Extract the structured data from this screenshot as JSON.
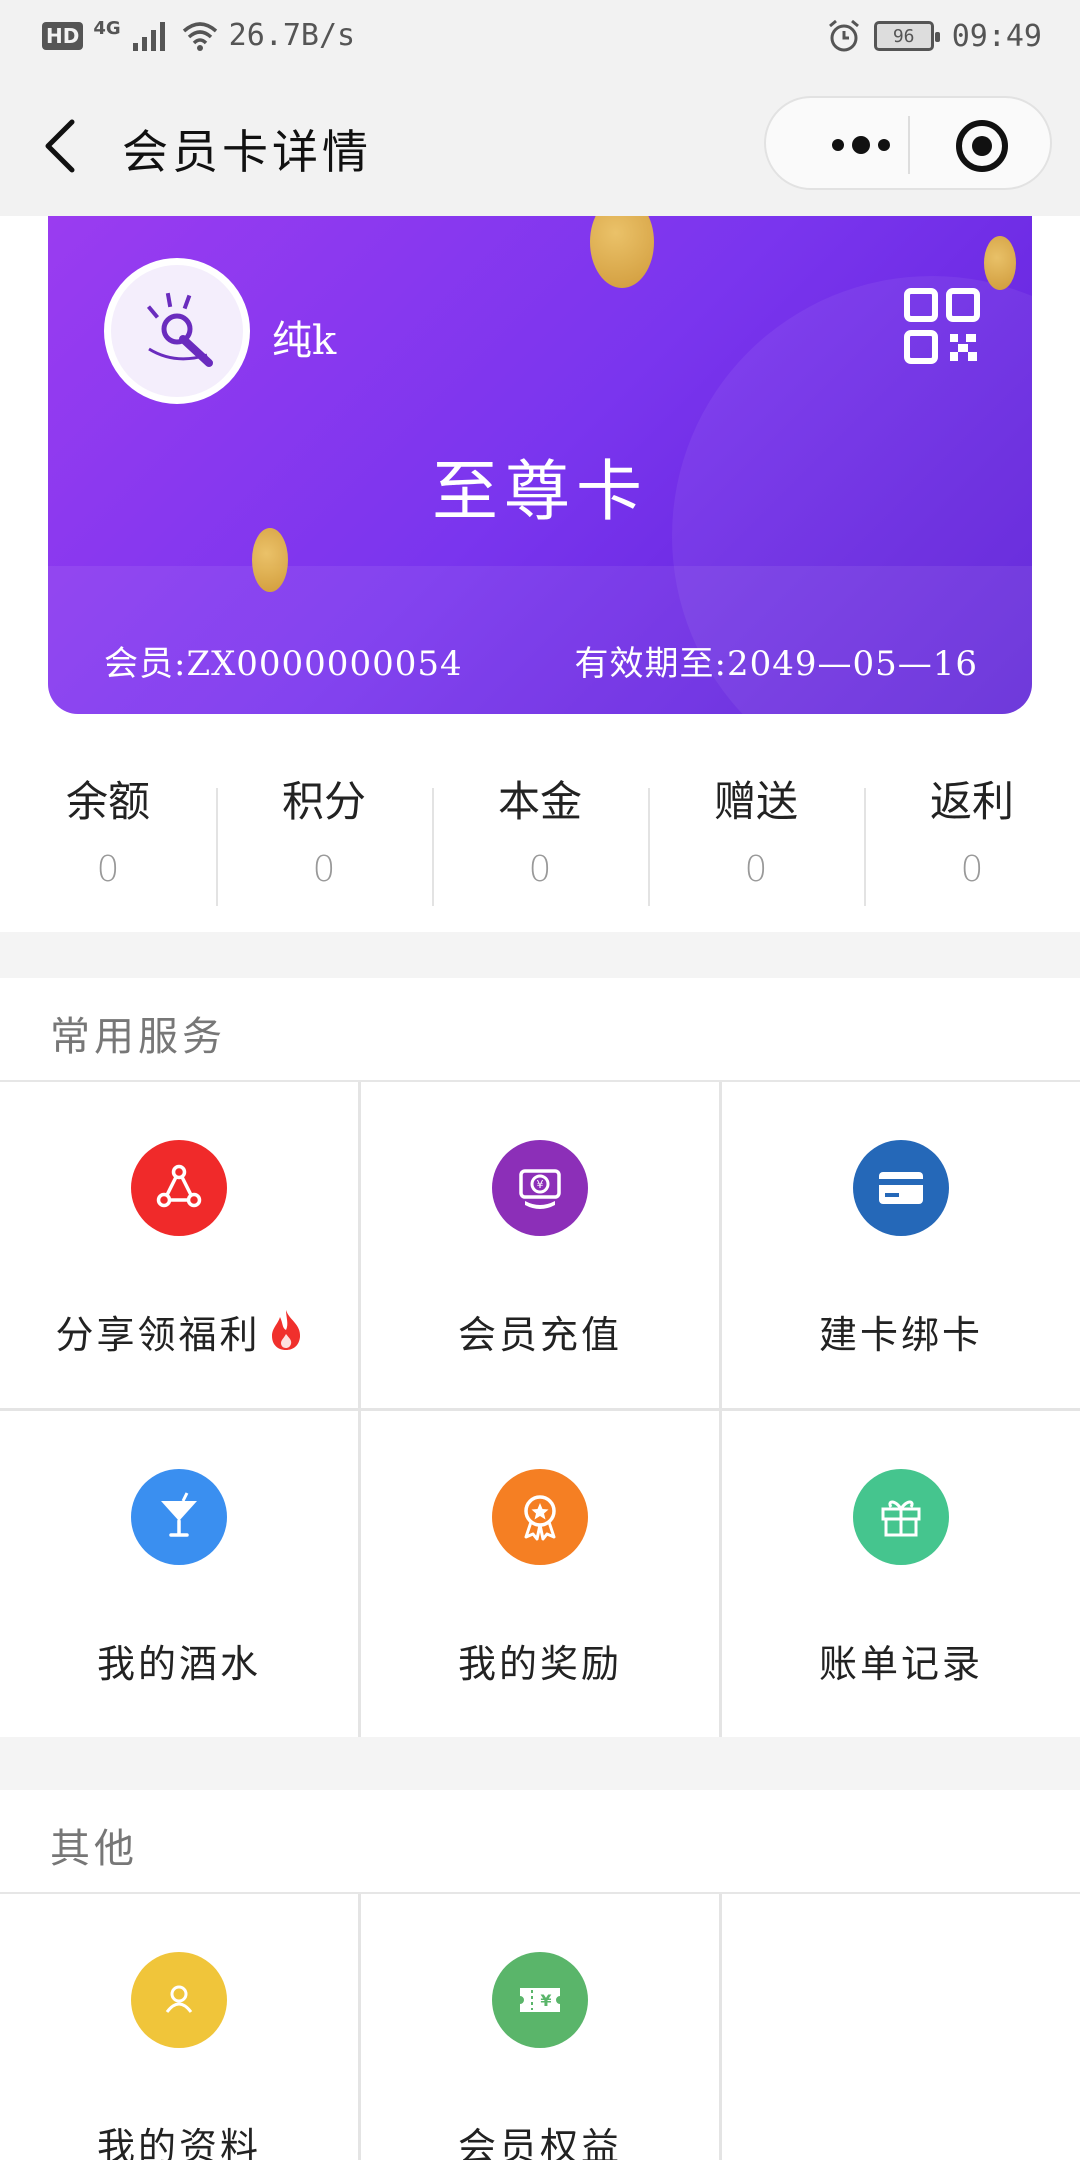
{
  "status_bar": {
    "hd": "HD",
    "network": "4G",
    "speed": "26.7B/s",
    "battery": "96",
    "time": "09:49"
  },
  "nav": {
    "title": "会员卡详情"
  },
  "card": {
    "username": "纯k",
    "level": "至尊卡",
    "member_no": "会员:ZX0000000054",
    "expiry": "有效期至:2049—05—16"
  },
  "stats": [
    {
      "label": "余额",
      "value": "0"
    },
    {
      "label": "积分",
      "value": "0"
    },
    {
      "label": "本金",
      "value": "0"
    },
    {
      "label": "赠送",
      "value": "0"
    },
    {
      "label": "返利",
      "value": "0"
    }
  ],
  "sections": {
    "common": {
      "title": "常用服务",
      "items": [
        {
          "label": "分享领福利",
          "icon": "share-icon",
          "color": "#f02a2a"
        },
        {
          "label": "会员充值",
          "icon": "recharge-icon",
          "color": "#8c2fb8"
        },
        {
          "label": "建卡绑卡",
          "icon": "card-icon",
          "color": "#2568b8"
        },
        {
          "label": "我的酒水",
          "icon": "cocktail-icon",
          "color": "#3a8ff0"
        },
        {
          "label": "我的奖励",
          "icon": "medal-icon",
          "color": "#f57f23"
        },
        {
          "label": "账单记录",
          "icon": "gift-icon",
          "color": "#45c58e"
        }
      ]
    },
    "other": {
      "title": "其他",
      "items": [
        {
          "label": "我的资料",
          "icon": "profile-icon",
          "color": "#f0c53a"
        },
        {
          "label": "会员权益",
          "icon": "ticket-icon",
          "color": "#5ab56a"
        }
      ]
    }
  }
}
